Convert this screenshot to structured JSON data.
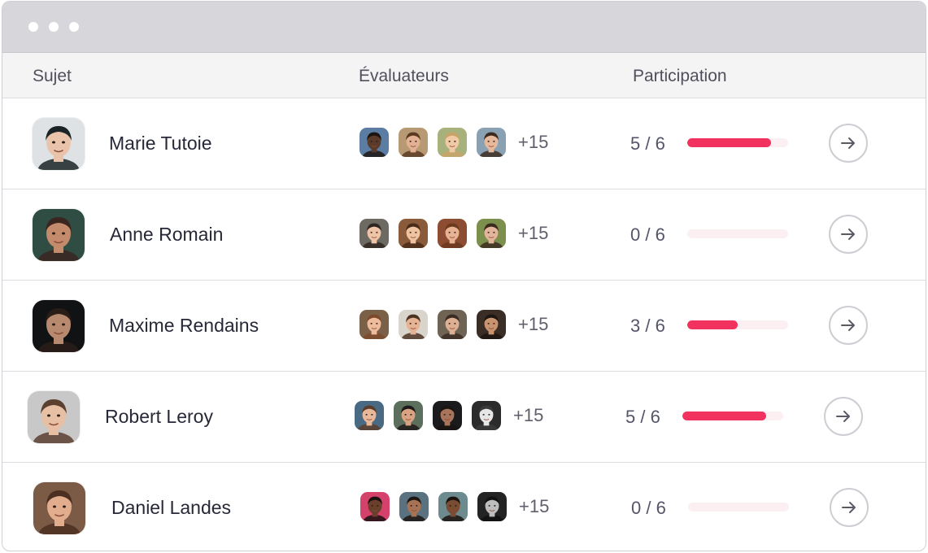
{
  "window": {
    "controls": [
      "dot",
      "dot",
      "dot"
    ]
  },
  "headers": {
    "subject": "Sujet",
    "raters": "Évaluateurs",
    "participation": "Participation"
  },
  "rows": [
    {
      "name": "Marie Tutoie",
      "avatar": {
        "bg": "#dfe2e4",
        "skin": "#e9c4ab",
        "hair": "#1a2326"
      },
      "raters": [
        {
          "bg": "#5b7da3",
          "skin": "#5a3a28",
          "hair": "#1c1410"
        },
        {
          "bg": "#b79a73",
          "skin": "#e2b092",
          "hair": "#5a3a22"
        },
        {
          "bg": "#a7b17c",
          "skin": "#f0c9a5",
          "hair": "#c9a368"
        },
        {
          "bg": "#8aa0b3",
          "skin": "#e7b99c",
          "hair": "#3b2a20"
        }
      ],
      "more": "+15",
      "score": "5 / 6",
      "progress": 0.83
    },
    {
      "name": "Anne Romain",
      "avatar": {
        "bg": "#2f4d43",
        "skin": "#c48a6c",
        "hair": "#3a2520"
      },
      "raters": [
        {
          "bg": "#6c6a62",
          "skin": "#efc4a6",
          "hair": "#2f2520"
        },
        {
          "bg": "#8a5b3a",
          "skin": "#f0c3a0",
          "hair": "#4a2a18"
        },
        {
          "bg": "#8d4d33",
          "skin": "#e8b393",
          "hair": "#6b3a1f"
        },
        {
          "bg": "#7d8f4c",
          "skin": "#e3b59a",
          "hair": "#3b2b1f"
        }
      ],
      "more": "+15",
      "score": "0 / 6",
      "progress": 0
    },
    {
      "name": "Maxime Rendains",
      "avatar": {
        "bg": "#111214",
        "skin": "#b78a70",
        "hair": "#2a1d17"
      },
      "raters": [
        {
          "bg": "#7b6048",
          "skin": "#eebc9c",
          "hair": "#7c4a2a"
        },
        {
          "bg": "#d9d4cc",
          "skin": "#e6b394",
          "hair": "#4a3323"
        },
        {
          "bg": "#6f6354",
          "skin": "#ddb094",
          "hair": "#3b2b22"
        },
        {
          "bg": "#3a2d25",
          "skin": "#c9946f",
          "hair": "#1e1612"
        }
      ],
      "more": "+15",
      "score": "3 / 6",
      "progress": 0.5
    },
    {
      "name": "Robert Leroy",
      "avatar": {
        "bg": "#c8c8c8",
        "skin": "#e6bfa4",
        "hair": "#5b4030"
      },
      "raters": [
        {
          "bg": "#4a6a84",
          "skin": "#e8b89a",
          "hair": "#5a3d2a"
        },
        {
          "bg": "#5c6f5d",
          "skin": "#d9a283",
          "hair": "#1e1a18"
        },
        {
          "bg": "#1b1b1d",
          "skin": "#a9755a",
          "hair": "#1a1412"
        },
        {
          "bg": "#2b2b2b",
          "skin": "#e6e6e6",
          "hair": "#3a3a3a"
        }
      ],
      "more": "+15",
      "score": "5 / 6",
      "progress": 0.83
    },
    {
      "name": "Daniel Landes",
      "avatar": {
        "bg": "#7b5a46",
        "skin": "#e2ad8c",
        "hair": "#4b2f20"
      },
      "raters": [
        {
          "bg": "#d4416a",
          "skin": "#6a3f2b",
          "hair": "#1a1010"
        },
        {
          "bg": "#5a7180",
          "skin": "#a77354",
          "hair": "#1d1612"
        },
        {
          "bg": "#6d8b8e",
          "skin": "#7a4c32",
          "hair": "#1a120e"
        },
        {
          "bg": "#232323",
          "skin": "#bdbdbd",
          "hair": "#111111"
        }
      ],
      "more": "+15",
      "score": "0 / 6",
      "progress": 0
    }
  ]
}
